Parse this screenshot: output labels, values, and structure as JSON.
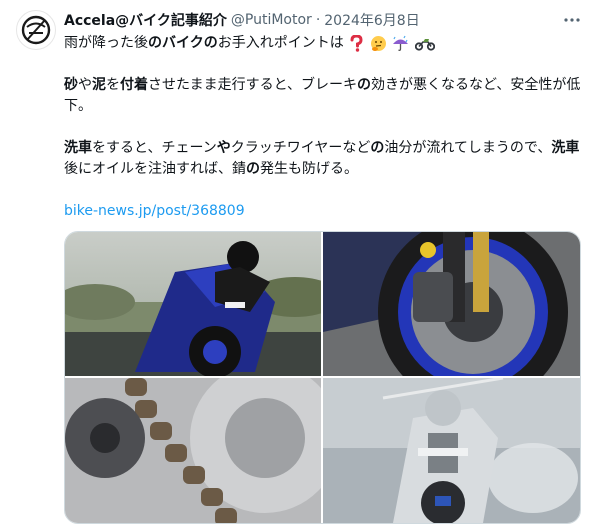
{
  "tweet": {
    "author_name": "Accela@バイク記事紹介",
    "author_handle": "@PutiMotor",
    "separator": "·",
    "date": "2024年6月8日",
    "line1_a": "雨が降った後",
    "line1_b": "のバイクの",
    "line1_c": "お手入れポイントは",
    "para2_a": "砂",
    "para2_b": "や",
    "para2_c": "泥",
    "para2_d": "を",
    "para2_e": "付着",
    "para2_f": "させたまま走行すると、ブレーキ",
    "para2_g": "の",
    "para2_h": "効きが悪くなるなど、安全性が低下。",
    "para3_a": "洗車",
    "para3_b": "をすると、チェーン",
    "para3_c": "や",
    "para3_d": "クラッチワイヤーなど",
    "para3_e": "の",
    "para3_f": "油分が流れてしまうので、",
    "para3_g": "洗車",
    "para3_h": "後にオイルを注油すれば、錆",
    "para3_i": "の",
    "para3_j": "発生も防げる。",
    "link": "bike-news.jp/post/368809"
  },
  "icons": {
    "avatar": "helmet-logo-icon",
    "more": "more-options-icon",
    "emoji": [
      "question-mark-emoji",
      "thinking-face-emoji",
      "umbrella-rain-emoji",
      "motorcycle-emoji"
    ]
  },
  "media": [
    "blue-motorcycle-leaning",
    "front-brake-disc",
    "drive-chain-sprocket",
    "motorcycle-pressure-wash"
  ],
  "colors": {
    "link": "#1d9bf0",
    "muted": "#536471",
    "text": "#0f1419",
    "border": "#cfd9de"
  }
}
